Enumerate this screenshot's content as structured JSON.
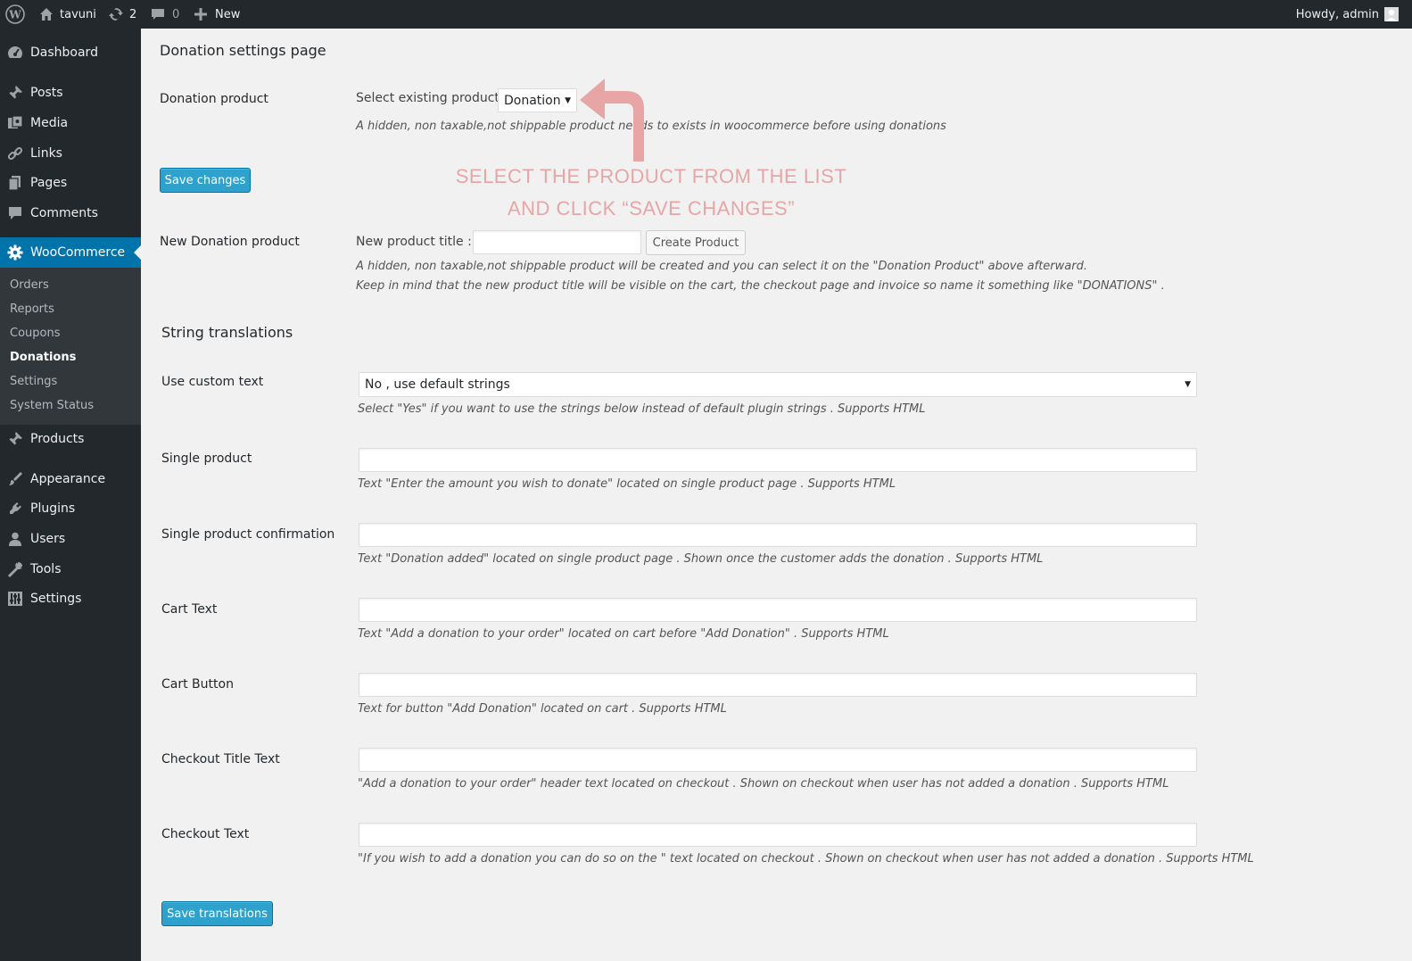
{
  "adminbar": {
    "site_name": "tavuni",
    "updates_count": "2",
    "comments_count": "0",
    "new_label": "New",
    "howdy": "Howdy, admin"
  },
  "sidebar": {
    "items": [
      {
        "label": "Dashboard",
        "icon": "dashboard-icon"
      },
      {
        "label": "Posts",
        "icon": "pin-icon"
      },
      {
        "label": "Media",
        "icon": "media-icon"
      },
      {
        "label": "Links",
        "icon": "link-icon"
      },
      {
        "label": "Pages",
        "icon": "pages-icon"
      },
      {
        "label": "Comments",
        "icon": "comment-icon"
      },
      {
        "label": "WooCommerce",
        "icon": "gear-icon"
      },
      {
        "label": "Products",
        "icon": "pin-icon"
      },
      {
        "label": "Appearance",
        "icon": "brush-icon"
      },
      {
        "label": "Plugins",
        "icon": "plug-icon"
      },
      {
        "label": "Users",
        "icon": "user-icon"
      },
      {
        "label": "Tools",
        "icon": "wrench-icon"
      },
      {
        "label": "Settings",
        "icon": "sliders-icon"
      }
    ],
    "submenu": [
      "Orders",
      "Reports",
      "Coupons",
      "Donations",
      "Settings",
      "System Status"
    ]
  },
  "page": {
    "title": "Donation settings page",
    "donation_product": {
      "label": "Donation product",
      "select_label": "Select existing product",
      "selected": "Donation",
      "desc": "A hidden, non taxable,not shippable product needs to exists in woocommerce before using donations"
    },
    "save_changes": "Save changes",
    "annotation": {
      "line1": "SELECT THE PRODUCT FROM THE LIST",
      "line2": "AND CLICK “SAVE CHANGES”"
    },
    "new_product": {
      "label": "New Donation product",
      "title_label": "New product title :",
      "create_button": "Create Product",
      "desc1": "A hidden, non taxable,not shippable product will be created and you can select it on the \"Donation Product\" above afterward.",
      "desc2": "Keep in mind that the new product title will be visible on the cart, the checkout page and invoice so name it something like \"DONATIONS\" ."
    },
    "translations": {
      "heading": "String translations",
      "use_custom": {
        "label": "Use custom text",
        "selected": "No , use default strings",
        "desc": "Select \"Yes\" if you want to use the strings below instead of default plugin strings . Supports HTML"
      },
      "fields": [
        {
          "label": "Single product",
          "desc": "Text \"Enter the amount you wish to donate\" located on single product page . Supports HTML"
        },
        {
          "label": "Single product confirmation",
          "desc": "Text \"Donation added\" located on single product page . Shown once the customer adds the donation . Supports HTML"
        },
        {
          "label": "Cart Text",
          "desc": "Text \"Add a donation to your order\" located on cart before \"Add Donation\" . Supports HTML"
        },
        {
          "label": "Cart Button",
          "desc": "Text for button \"Add Donation\" located on cart . Supports HTML"
        },
        {
          "label": "Checkout Title Text",
          "desc": "\"Add a donation to your order\" header text located on checkout . Shown on checkout when user has not added a donation . Supports HTML"
        },
        {
          "label": "Checkout Text",
          "desc": "\"If you wish to add a donation you can do so on the \" text located on checkout . Shown on checkout when user has not added a donation . Supports HTML"
        }
      ],
      "save_button": "Save translations"
    }
  }
}
